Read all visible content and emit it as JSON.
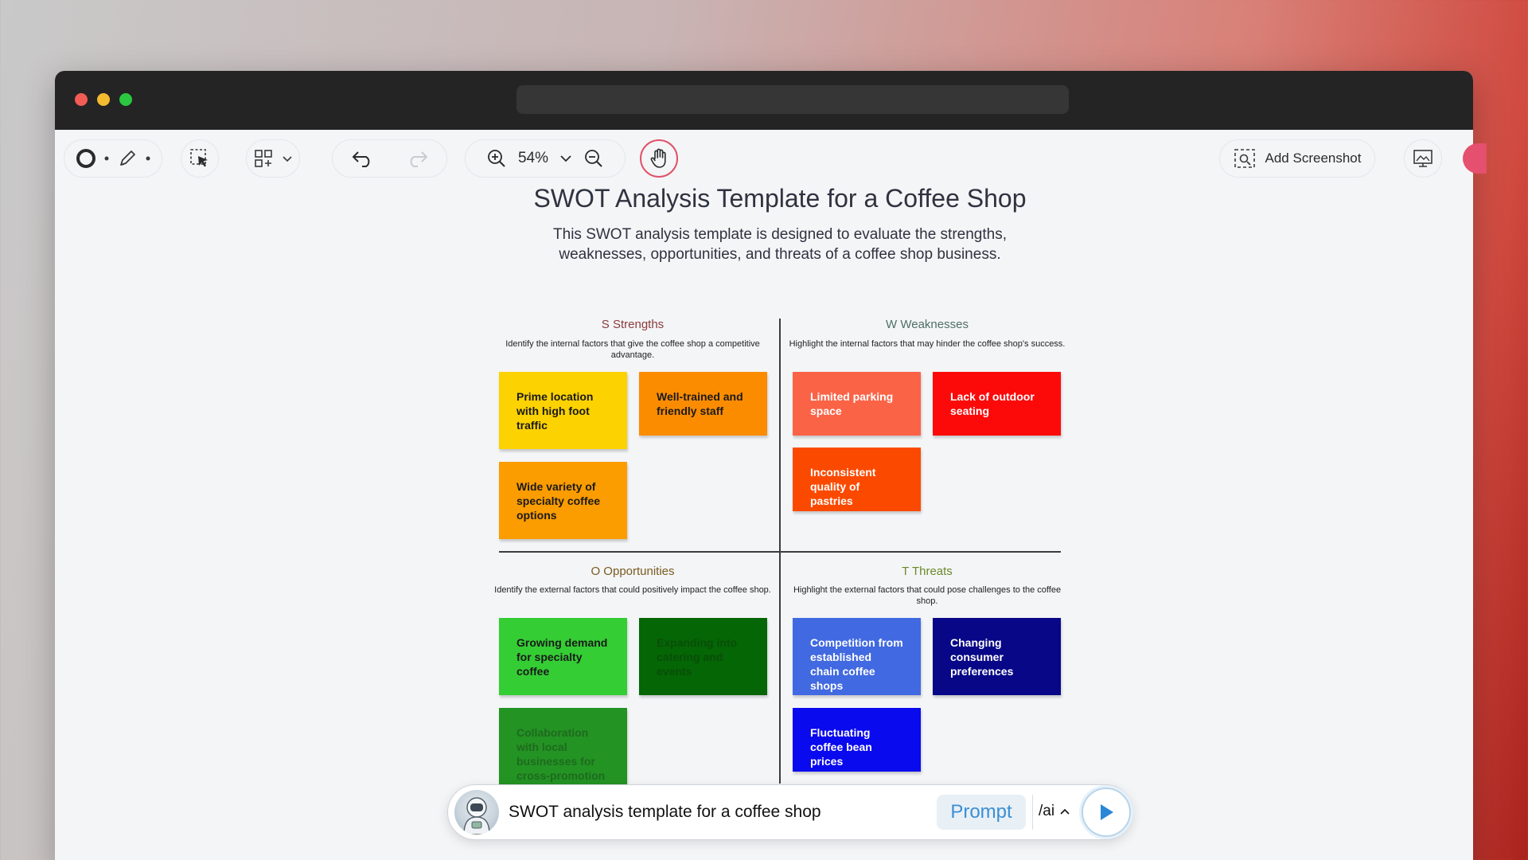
{
  "toolbar": {
    "zoom_level": "54%",
    "add_screenshot_label": "Add Screenshot"
  },
  "page": {
    "title": "SWOT Analysis Template for a Coffee Shop",
    "description": "This SWOT analysis template is designed to evaluate the strengths, weaknesses, opportunities, and threats of a coffee shop business."
  },
  "swot": {
    "strengths": {
      "title": "S Strengths",
      "title_color": "#8a3b3b",
      "description": "Identify the internal factors that give the coffee shop a competitive advantage.",
      "notes": [
        {
          "text": "Prime location with high foot traffic",
          "color": "#fcd200",
          "text_color": "#1a1a1a"
        },
        {
          "text": "Well-trained and friendly staff",
          "color": "#fb8c00",
          "text_color": "#1a1a1a"
        },
        {
          "text": "Wide variety of specialty coffee options",
          "color": "#fb9c00",
          "text_color": "#1a1a1a"
        }
      ]
    },
    "weaknesses": {
      "title": "W Weaknesses",
      "title_color": "#4f6f66",
      "description": "Highlight the internal factors that may hinder the coffee shop's success.",
      "notes": [
        {
          "text": "Limited parking space",
          "color": "#fb6347",
          "text_color": "#ffffff"
        },
        {
          "text": "Lack of outdoor seating",
          "color": "#fc0a0a",
          "text_color": "#ffffff"
        },
        {
          "text": "Inconsistent quality of pastries",
          "color": "#fb4a00",
          "text_color": "#ffffff"
        }
      ]
    },
    "opportunities": {
      "title": "O Opportunities",
      "title_color": "#7a5a1f",
      "description": "Identify the external factors that could positively impact the coffee shop.",
      "notes": [
        {
          "text": "Growing demand for specialty coffee",
          "color": "#34cd34",
          "text_color": "#1a1a1a"
        },
        {
          "text": "Expanding into catering and events",
          "color": "#046604",
          "text_color": "#0a4d0a"
        },
        {
          "text": "Collaboration with local businesses for cross-promotion",
          "color": "#239323",
          "text_color": "#1f6a1f"
        }
      ]
    },
    "threats": {
      "title": "T Threats",
      "title_color": "#6b8a2a",
      "description": "Highlight the external factors that could pose challenges to the coffee shop.",
      "notes": [
        {
          "text": "Competition from established chain coffee shops",
          "color": "#4169e1",
          "text_color": "#ffffff"
        },
        {
          "text": "Changing consumer preferences",
          "color": "#070787",
          "text_color": "#ffffff"
        },
        {
          "text": "Fluctuating coffee bean prices",
          "color": "#0a0aef",
          "text_color": "#ffffff"
        }
      ]
    }
  },
  "prompt_bar": {
    "input_value": "SWOT analysis template for a coffee shop",
    "prompt_label": "Prompt",
    "ai_command": "/ai"
  }
}
